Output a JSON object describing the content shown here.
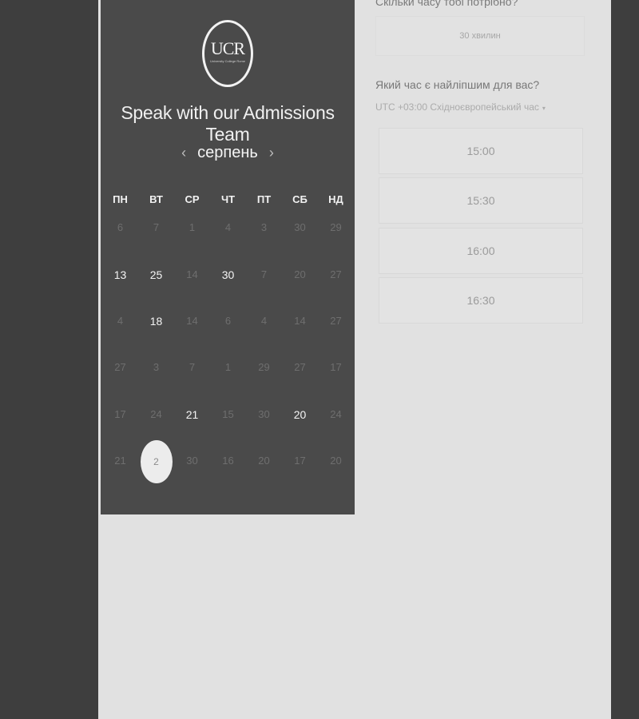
{
  "brand": {
    "logo_text": "UCR",
    "logo_subtext": "University College Rome"
  },
  "calendar": {
    "headline": "Speak with our Admissions Team",
    "month": "серпень",
    "prev_icon": "‹",
    "next_icon": "›",
    "weekdays": [
      "ПН",
      "ВТ",
      "СР",
      "ЧТ",
      "ПТ",
      "СБ",
      "НД"
    ],
    "weeks": [
      [
        {
          "d": "6",
          "a": false
        },
        {
          "d": "7",
          "a": false
        },
        {
          "d": "1",
          "a": false
        },
        {
          "d": "4",
          "a": false
        },
        {
          "d": "3",
          "a": false
        },
        {
          "d": "30",
          "a": false
        },
        {
          "d": "29",
          "a": false
        }
      ],
      [
        {
          "d": "13",
          "a": true
        },
        {
          "d": "25",
          "a": true
        },
        {
          "d": "14",
          "a": false
        },
        {
          "d": "30",
          "a": true
        },
        {
          "d": "7",
          "a": false
        },
        {
          "d": "20",
          "a": false
        },
        {
          "d": "27",
          "a": false
        }
      ],
      [
        {
          "d": "4",
          "a": false
        },
        {
          "d": "18",
          "a": true
        },
        {
          "d": "14",
          "a": false
        },
        {
          "d": "6",
          "a": false
        },
        {
          "d": "4",
          "a": false
        },
        {
          "d": "14",
          "a": false
        },
        {
          "d": "27",
          "a": false
        }
      ],
      [
        {
          "d": "27",
          "a": false
        },
        {
          "d": "3",
          "a": false
        },
        {
          "d": "7",
          "a": false
        },
        {
          "d": "1",
          "a": false
        },
        {
          "d": "29",
          "a": false
        },
        {
          "d": "27",
          "a": false
        },
        {
          "d": "17",
          "a": false
        }
      ],
      [
        {
          "d": "17",
          "a": false
        },
        {
          "d": "24",
          "a": false
        },
        {
          "d": "21",
          "a": true
        },
        {
          "d": "15",
          "a": false
        },
        {
          "d": "30",
          "a": false
        },
        {
          "d": "20",
          "a": true
        },
        {
          "d": "24",
          "a": false
        }
      ],
      [
        {
          "d": "21",
          "a": false
        },
        {
          "d": "2",
          "a": true,
          "s": true
        },
        {
          "d": "30",
          "a": false
        },
        {
          "d": "16",
          "a": false
        },
        {
          "d": "20",
          "a": false
        },
        {
          "d": "17",
          "a": false
        },
        {
          "d": "20",
          "a": false
        }
      ]
    ]
  },
  "booking": {
    "duration_question": "Скільки часу тобі потрібно?",
    "duration_value": "30 хвилин",
    "time_question": "Який час є найліпшим для вас?",
    "timezone": "UTC +03:00 Східноєвропейський час",
    "timezone_caret": "▾",
    "slots": [
      "15:00",
      "15:30",
      "16:00",
      "16:30"
    ]
  }
}
